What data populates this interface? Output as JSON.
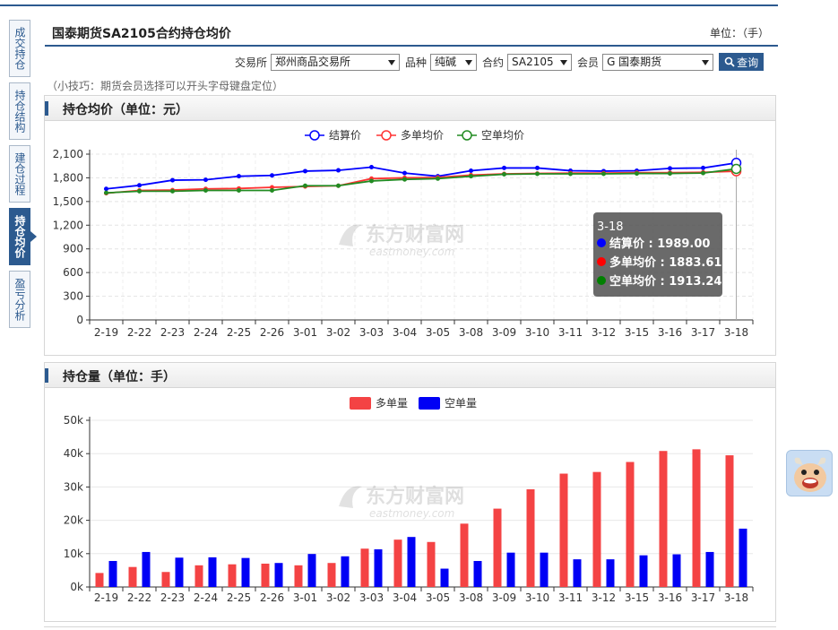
{
  "sidebar": {
    "items": [
      {
        "label": "成交持仓",
        "active": false
      },
      {
        "label": "持仓结构",
        "active": false
      },
      {
        "label": "建仓过程",
        "active": false
      },
      {
        "label": "持仓均价",
        "active": true
      },
      {
        "label": "盈亏分析",
        "active": false
      }
    ]
  },
  "header": {
    "title": "国泰期货SA2105合约持仓均价",
    "unit": "单位：（手）"
  },
  "filters": {
    "exchange_label": "交易所",
    "exchange_value": "郑州商品交易所",
    "variety_label": "品种",
    "variety_value": "纯碱",
    "contract_label": "合约",
    "contract_value": "SA2105",
    "member_label": "会员",
    "member_value": "G 国泰期货",
    "query_label": "查询"
  },
  "tip": "（小技巧：期货会员选择可以开头字母键盘定位）",
  "watermark": {
    "cn": "东方财富网",
    "en": "eastmoney.com"
  },
  "avg_panel": {
    "title": "持仓均价（单位：元）",
    "tooltip": {
      "date": "3-18",
      "rows": [
        {
          "label": "结算价",
          "value": "1989.00",
          "color": "#0000ff"
        },
        {
          "label": "多单均价",
          "value": "1883.61",
          "color": "#ff0000"
        },
        {
          "label": "空单均价",
          "value": "1913.24",
          "color": "#008000"
        }
      ]
    }
  },
  "pos_panel": {
    "title": "持仓量（单位：手）"
  },
  "chart_data": [
    {
      "type": "line",
      "categories": [
        "2-19",
        "2-22",
        "2-23",
        "2-24",
        "2-25",
        "2-26",
        "3-01",
        "3-02",
        "3-03",
        "3-04",
        "3-05",
        "3-08",
        "3-09",
        "3-10",
        "3-11",
        "3-12",
        "3-15",
        "3-16",
        "3-17",
        "3-18"
      ],
      "series": [
        {
          "name": "结算价",
          "color": "#0000ff",
          "values": [
            1660,
            1705,
            1770,
            1775,
            1820,
            1830,
            1885,
            1895,
            1935,
            1860,
            1820,
            1890,
            1925,
            1925,
            1890,
            1885,
            1890,
            1920,
            1925,
            1989
          ]
        },
        {
          "name": "多单均价",
          "color": "#ff3333",
          "values": [
            1605,
            1640,
            1645,
            1660,
            1665,
            1680,
            1690,
            1700,
            1790,
            1800,
            1805,
            1835,
            1850,
            1855,
            1860,
            1860,
            1865,
            1865,
            1870,
            1883.61
          ]
        },
        {
          "name": "空单均价",
          "color": "#228b22",
          "values": [
            1610,
            1630,
            1630,
            1640,
            1640,
            1640,
            1700,
            1700,
            1760,
            1780,
            1790,
            1820,
            1845,
            1850,
            1850,
            1850,
            1855,
            1855,
            1860,
            1913.24
          ]
        }
      ],
      "yticks": [
        "0",
        "300",
        "600",
        "900",
        "1,200",
        "1,500",
        "1,800",
        "2,100"
      ],
      "ylim": [
        0,
        2100
      ],
      "legend": "top-center",
      "grid": true
    },
    {
      "type": "bar",
      "categories": [
        "2-19",
        "2-22",
        "2-23",
        "2-24",
        "2-25",
        "2-26",
        "3-01",
        "3-02",
        "3-03",
        "3-04",
        "3-05",
        "3-08",
        "3-09",
        "3-10",
        "3-11",
        "3-12",
        "3-15",
        "3-16",
        "3-17",
        "3-18"
      ],
      "series": [
        {
          "name": "多单量",
          "color": "#f44344",
          "values": [
            4200,
            6000,
            4500,
            6500,
            6800,
            7000,
            6500,
            7200,
            11500,
            14200,
            13500,
            19000,
            23500,
            29300,
            34000,
            34500,
            37500,
            40800,
            41300,
            39500
          ]
        },
        {
          "name": "空单量",
          "color": "#0000f5",
          "values": [
            7800,
            10500,
            8800,
            8900,
            8700,
            7200,
            9900,
            9200,
            11300,
            15000,
            5500,
            7800,
            10300,
            10300,
            8300,
            8300,
            9500,
            9800,
            10500,
            17500
          ]
        }
      ],
      "yticks": [
        "0k",
        "10k",
        "20k",
        "30k",
        "40k",
        "50k"
      ],
      "ylim": [
        0,
        50000
      ],
      "legend": "top-center",
      "grid": true
    }
  ]
}
